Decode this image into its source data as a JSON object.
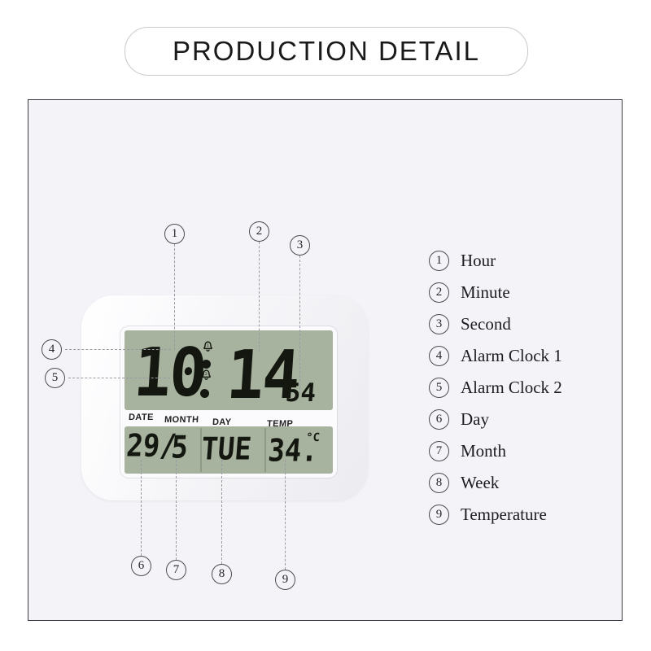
{
  "header": {
    "title": "PRODUCTION DETAIL"
  },
  "device": {
    "name": "digital-alarm-clock",
    "lcd_color": "#a7b39e",
    "body_color": "#f6f6f8",
    "display": {
      "hour": "10",
      "minute": "14",
      "second": "54",
      "alarm1_icon": "bell-icon",
      "alarm2_icon": "bell-icon",
      "labels": {
        "date": "DATE",
        "month": "MONTH",
        "day": "DAY",
        "temp": "TEMP"
      },
      "values": {
        "date": "29/",
        "month": "5",
        "day": "TUE",
        "temp": "34.",
        "temp_unit": "°C"
      }
    }
  },
  "callouts": [
    {
      "number": "1",
      "target": "hour"
    },
    {
      "number": "2",
      "target": "minute"
    },
    {
      "number": "3",
      "target": "second"
    },
    {
      "number": "4",
      "target": "alarm-clock-1"
    },
    {
      "number": "5",
      "target": "alarm-clock-2"
    },
    {
      "number": "6",
      "target": "day"
    },
    {
      "number": "7",
      "target": "month"
    },
    {
      "number": "8",
      "target": "week"
    },
    {
      "number": "9",
      "target": "temperature"
    }
  ],
  "legend": {
    "items": [
      {
        "number": "1",
        "label": "Hour"
      },
      {
        "number": "2",
        "label": "Minute"
      },
      {
        "number": "3",
        "label": "Second"
      },
      {
        "number": "4",
        "label": "Alarm Clock 1"
      },
      {
        "number": "5",
        "label": "Alarm Clock 2"
      },
      {
        "number": "6",
        "label": "Day"
      },
      {
        "number": "7",
        "label": "Month"
      },
      {
        "number": "8",
        "label": "Week"
      },
      {
        "number": "9",
        "label": "Temperature"
      }
    ]
  }
}
